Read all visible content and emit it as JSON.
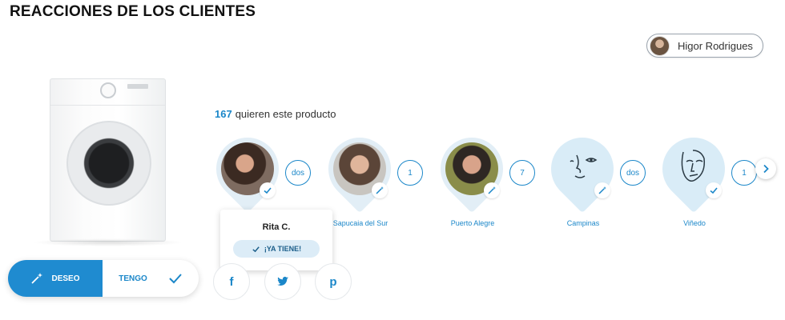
{
  "page": {
    "title": "REACCIONES DE LOS CLIENTES"
  },
  "user": {
    "name": "Higor Rodrigues"
  },
  "product": {
    "want_count": "167",
    "want_text": "quieren este producto"
  },
  "reactions": [
    {
      "city": "",
      "count": "dos",
      "badge_icon": "check-icon",
      "tooltip": {
        "name": "Rita C.",
        "tag": "¡YA TIENE!"
      }
    },
    {
      "city": "Sapucaia del Sur",
      "count": "1",
      "badge_icon": "magic-wand-icon"
    },
    {
      "city": "Puerto Alegre",
      "count": "7",
      "badge_icon": "magic-wand-icon"
    },
    {
      "city": "Campinas",
      "count": "dos",
      "badge_icon": "magic-wand-icon"
    },
    {
      "city": "Viñedo",
      "count": "1",
      "badge_icon": "check-icon"
    }
  ],
  "actions": {
    "deseo_label": "DESEO",
    "tengo_label": "TENGO"
  },
  "share": {
    "facebook": "f",
    "twitter": "twitter-bird-icon",
    "pinterest": "p"
  },
  "colors": {
    "accent": "#1f8bd0",
    "accent_text": "#1b87c9",
    "bubble": "#e2eef6"
  }
}
